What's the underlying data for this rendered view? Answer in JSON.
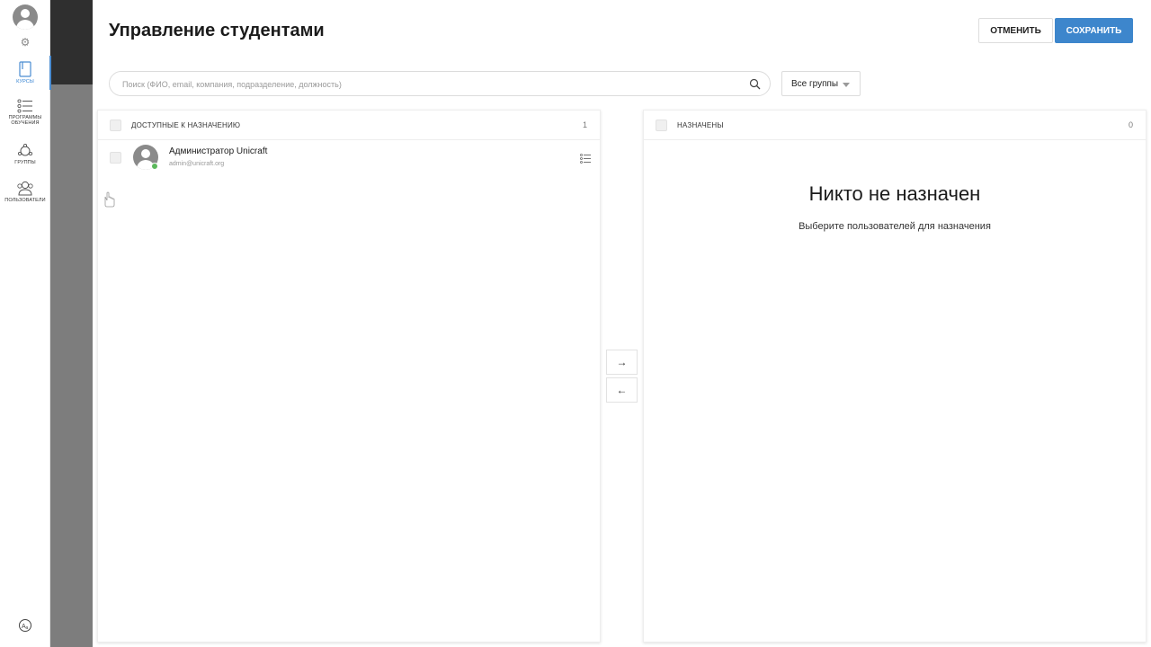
{
  "nav": {
    "avatar_icon": "user-avatar-icon",
    "settings_icon": "gear-icon",
    "items": [
      {
        "label": "Курсы",
        "icon": "book-icon",
        "active": true
      },
      {
        "label": "Программы обучения",
        "icon": "list-icon",
        "active": false
      },
      {
        "label": "Группы",
        "icon": "group-icon",
        "active": false
      },
      {
        "label": "Пользователи",
        "icon": "users-icon",
        "active": false
      }
    ],
    "lang_icon": "language-icon"
  },
  "modal": {
    "title": "Управление студентами",
    "cancel_label": "Отменить",
    "save_label": "Сохранить",
    "search_placeholder": "Поиск (ФИО, email, компания, подразделение, должность)",
    "groups_selected": "Все группы"
  },
  "available": {
    "header": "Доступные к назначению",
    "count": "1",
    "users": [
      {
        "name": "Администратор Unicraft",
        "email": "admin@unicraft.org"
      }
    ]
  },
  "transfer": {
    "to_right": "→",
    "to_left": "←"
  },
  "assigned": {
    "header": "Назначены",
    "count": "0",
    "empty_title": "Никто не назначен",
    "empty_subtitle": "Выберите пользователей для назначения"
  },
  "colors": {
    "accent": "#3d86cc",
    "online": "#5cb85c"
  }
}
